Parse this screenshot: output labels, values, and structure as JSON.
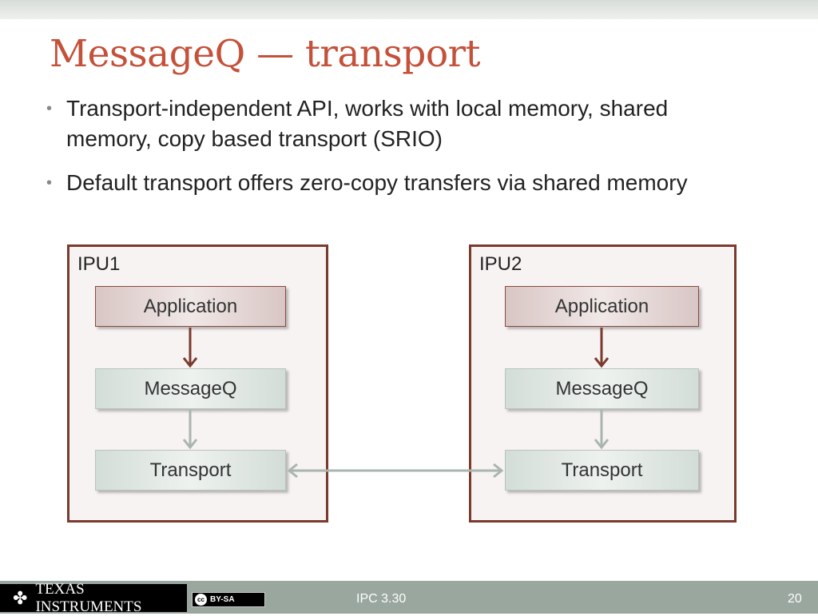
{
  "title": "MessageQ — transport",
  "bullets": [
    {
      "line1": "Transport-independent API, works with local memory, shared",
      "line2": "memory, copy based transport (SRIO)"
    },
    {
      "line1": "Default transport offers zero-copy transfers via shared memory"
    }
  ],
  "diagram": {
    "ipu1": {
      "label": "IPU1",
      "blocks": [
        "Application",
        "MessageQ",
        "Transport"
      ]
    },
    "ipu2": {
      "label": "IPU2",
      "blocks": [
        "Application",
        "MessageQ",
        "Transport"
      ]
    }
  },
  "footer": {
    "logo": "Texas Instruments",
    "license": "BY-SA",
    "cc": "cc",
    "center": "IPC 3.30",
    "page": "20"
  },
  "colors": {
    "title": "#c4513a",
    "frame": "#7a3a2e",
    "footer": "#9aa79f"
  }
}
